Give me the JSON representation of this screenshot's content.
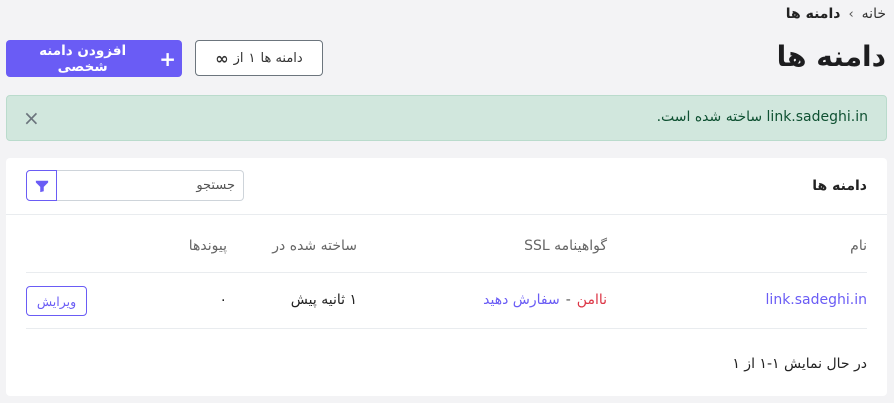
{
  "breadcrumb": {
    "home": "خانه",
    "separator": "›",
    "current": "دامنه ها"
  },
  "page": {
    "title": "دامنه ها"
  },
  "quota": {
    "label": "دامنه ها",
    "used": "۱",
    "of": "از",
    "limit": "∞"
  },
  "actions": {
    "add_domain_label": "افزودن دامنه شخصی",
    "add_icon": "+"
  },
  "alert": {
    "domain": "link.sadeghi.in",
    "message": "ساخته شده است.",
    "close_icon": "×",
    "type": "success"
  },
  "card": {
    "title": "دامنه ها",
    "search": {
      "placeholder": "جستجو",
      "value": ""
    },
    "filter_icon": "filter-icon"
  },
  "table": {
    "headers": {
      "name": "نام",
      "ssl": "گواهینامه SSL",
      "created": "ساخته شده در",
      "links": "پیوندها"
    },
    "rows": [
      {
        "name": "link.sadeghi.in",
        "ssl_status": "ناامن",
        "ssl_separator": "-",
        "ssl_action": "سفارش دهید",
        "created": "۱ ثانیه پیش",
        "links": "۰",
        "edit_label": "ویرایش"
      }
    ]
  },
  "footer": {
    "showing": "در حال نمایش ۱-۱ از ۱"
  },
  "colors": {
    "primary": "#6a5cf5",
    "success_bg": "#d1e7dd",
    "danger": "#dc3545"
  }
}
